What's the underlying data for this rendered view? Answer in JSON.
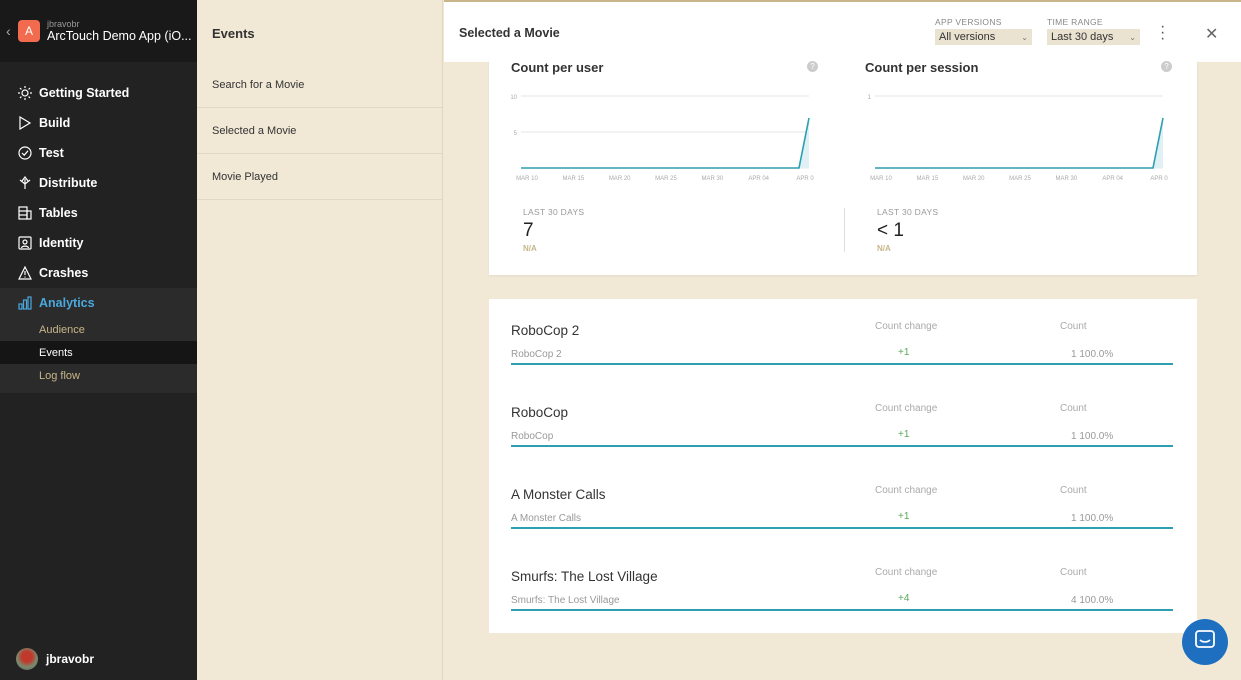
{
  "app": {
    "user_small": "jbravobr",
    "name": "ArcTouch Demo App (iO...",
    "icon_letter": "A",
    "brand_color": "#f26b4f"
  },
  "nav": [
    {
      "label": "Getting Started",
      "icon": "sun-icon"
    },
    {
      "label": "Build",
      "icon": "play-icon"
    },
    {
      "label": "Test",
      "icon": "check-circle-icon"
    },
    {
      "label": "Distribute",
      "icon": "distribute-icon"
    },
    {
      "label": "Tables",
      "icon": "table-icon"
    },
    {
      "label": "Identity",
      "icon": "identity-icon"
    },
    {
      "label": "Crashes",
      "icon": "warning-icon"
    },
    {
      "label": "Analytics",
      "icon": "bar-chart-icon"
    }
  ],
  "analytics_sub": [
    "Audience",
    "Events",
    "Log flow"
  ],
  "footer_user": "jbravobr",
  "events": {
    "title": "Events",
    "items": [
      "Search for a Movie",
      "Selected a Movie",
      "Movie Played"
    ]
  },
  "header": {
    "title": "Selected a Movie",
    "app_versions_label": "APP VERSIONS",
    "app_versions_value": "All versions",
    "time_range_label": "TIME RANGE",
    "time_range_value": "Last 30 days"
  },
  "stats": [
    {
      "title": "Count per user",
      "caption": "LAST 30 DAYS",
      "value": "7",
      "change": "N/A",
      "yticks": [
        "10",
        "5"
      ],
      "xticks": [
        "MAR 10",
        "MAR 15",
        "MAR 20",
        "MAR 25",
        "MAR 30",
        "APR 04",
        "APR 0"
      ]
    },
    {
      "title": "Count per session",
      "caption": "LAST 30 DAYS",
      "value": "< 1",
      "change": "N/A",
      "yticks": [
        "1"
      ],
      "xticks": [
        "MAR 10",
        "MAR 15",
        "MAR 20",
        "MAR 25",
        "MAR 30",
        "APR 04",
        "APR 0"
      ]
    }
  ],
  "list_headers": {
    "change": "Count change",
    "count": "Count"
  },
  "rows": [
    {
      "name": "RoboCop 2",
      "sub": "RoboCop 2",
      "change": "+1",
      "count": "1  100.0%"
    },
    {
      "name": "RoboCop",
      "sub": "RoboCop",
      "change": "+1",
      "count": "1  100.0%"
    },
    {
      "name": "A Monster Calls",
      "sub": "A Monster Calls",
      "change": "+1",
      "count": "1  100.0%"
    },
    {
      "name": "Smurfs: The Lost Village",
      "sub": "Smurfs: The Lost Village",
      "change": "+4",
      "count": "4  100.0%"
    }
  ],
  "colors": {
    "accent": "#2c9fb0",
    "active_nav": "#4aa8df",
    "chat": "#1f6fc0"
  }
}
